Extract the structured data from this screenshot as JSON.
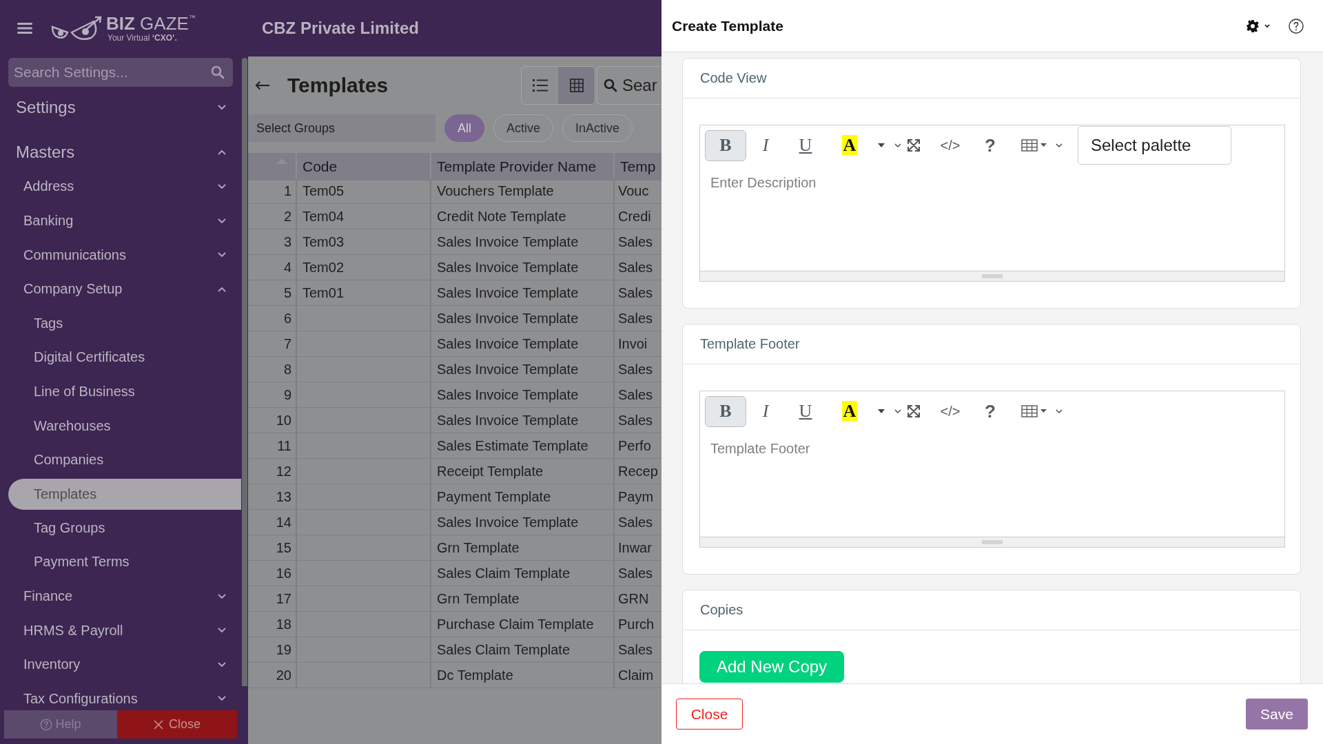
{
  "brand": {
    "name_1": "BIZ",
    "name_2": "GAZE",
    "tm": "™",
    "tagline": "Your Virtual **‘CXO’.**"
  },
  "company": "CBZ Private Limited",
  "sidebar": {
    "search": {
      "placeholder": "Search Settings..."
    },
    "items": [
      {
        "label": "Settings",
        "expanded": false
      },
      {
        "label": "Masters",
        "expanded": true,
        "children": [
          {
            "label": "Address",
            "expanded": false
          },
          {
            "label": "Banking",
            "expanded": false
          },
          {
            "label": "Communications",
            "expanded": false
          },
          {
            "label": "Company Setup",
            "expanded": true,
            "children": [
              {
                "label": "Tags",
                "selected": false
              },
              {
                "label": "Digital Certificates",
                "selected": false
              },
              {
                "label": "Line of Business",
                "selected": false
              },
              {
                "label": "Warehouses",
                "selected": false
              },
              {
                "label": "Companies",
                "selected": false
              },
              {
                "label": "Templates",
                "selected": true
              },
              {
                "label": "Tag Groups",
                "selected": false
              },
              {
                "label": "Payment Terms",
                "selected": false
              }
            ]
          },
          {
            "label": "Finance",
            "expanded": false
          },
          {
            "label": "HRMS & Payroll",
            "expanded": false
          },
          {
            "label": "Inventory",
            "expanded": false
          },
          {
            "label": "Tax Configurations",
            "expanded": false
          }
        ]
      }
    ],
    "footer": {
      "help": "Help",
      "close": "Close"
    }
  },
  "main": {
    "title": "Templates",
    "views": [
      {
        "kind": "list",
        "selected": false
      },
      {
        "kind": "grid",
        "selected": true
      }
    ],
    "search": {
      "placeholder": "Sear"
    },
    "groups": {
      "placeholder": "Select Groups"
    },
    "filters": [
      {
        "label": "All",
        "selected": true
      },
      {
        "label": "Active",
        "selected": false
      },
      {
        "label": "InActive",
        "selected": false
      }
    ],
    "table": {
      "columns": [
        "Code",
        "Template Provider Name",
        "Temp"
      ],
      "rows": [
        {
          "number": "1",
          "code": "Tem05",
          "provider": "Vouchers Template",
          "column_3": "Vouc"
        },
        {
          "number": "2",
          "code": "Tem04",
          "provider": "Credit Note Template",
          "column_3": "Credi"
        },
        {
          "number": "3",
          "code": "Tem03",
          "provider": "Sales Invoice Template",
          "column_3": "Sales"
        },
        {
          "number": "4",
          "code": "Tem02",
          "provider": "Sales Invoice Template",
          "column_3": "Sales"
        },
        {
          "number": "5",
          "code": "Tem01",
          "provider": "Sales Invoice Template",
          "column_3": "Sales"
        },
        {
          "number": "6",
          "provider": "Sales Invoice Template",
          "column_3": "Sales"
        },
        {
          "number": "7",
          "provider": "Sales Invoice Template",
          "column_3": "Invoi"
        },
        {
          "number": "8",
          "provider": "Sales Invoice Template",
          "column_3": "Sales"
        },
        {
          "number": "9",
          "provider": "Sales Invoice Template",
          "column_3": "Sales"
        },
        {
          "number": "10",
          "provider": "Sales Invoice Template",
          "column_3": "Sales"
        },
        {
          "number": "11",
          "provider": "Sales Estimate Template",
          "column_3": "Perfo"
        },
        {
          "number": "12",
          "provider": "Receipt Template",
          "column_3": "Recep"
        },
        {
          "number": "13",
          "provider": "Payment Template",
          "column_3": "Paym"
        },
        {
          "number": "14",
          "provider": "Sales Invoice Template",
          "column_3": "Sales"
        },
        {
          "number": "15",
          "provider": "Grn Template",
          "column_3": "Inwar"
        },
        {
          "number": "16",
          "provider": "Sales Claim Template",
          "column_3": "Sales"
        },
        {
          "number": "17",
          "provider": "Grn Template",
          "column_3": "GRN"
        },
        {
          "number": "18",
          "provider": "Purchase Claim Template",
          "column_3": "Purch"
        },
        {
          "number": "19",
          "provider": "Sales Claim Template",
          "column_3": "Sales"
        },
        {
          "number": "20",
          "provider": "Dc Template",
          "column_3": "Claim"
        }
      ]
    }
  },
  "drawer": {
    "title": "Create Template",
    "sections": [
      {
        "kind": "editor",
        "title": "Code View",
        "placeholder": "Enter Description",
        "palette": {
          "placeholder": "Select palette"
        },
        "toolbar": [
          {
            "kind": "bold",
            "label": "B",
            "active": true
          },
          {
            "kind": "italic",
            "label": "I",
            "active": false
          },
          {
            "kind": "underline",
            "label": "U",
            "active": false
          },
          {
            "kind": "highlight",
            "label": "A",
            "active": false
          },
          {
            "kind": "caret",
            "active": false
          },
          {
            "kind": "chevron",
            "active": false
          },
          {
            "kind": "expand",
            "active": false
          },
          {
            "kind": "code",
            "label": "</>",
            "active": false
          },
          {
            "kind": "help",
            "label": "?",
            "active": false
          },
          {
            "kind": "table",
            "active": false
          },
          {
            "kind": "chevron",
            "active": false
          }
        ]
      },
      {
        "kind": "editor",
        "title": "Template Footer",
        "placeholder": "Template Footer",
        "toolbar": [
          {
            "kind": "bold",
            "label": "B",
            "active": true
          },
          {
            "kind": "italic",
            "label": "I",
            "active": false
          },
          {
            "kind": "underline",
            "label": "U",
            "active": false
          },
          {
            "kind": "highlight",
            "label": "A",
            "active": false
          },
          {
            "kind": "caret",
            "active": false
          },
          {
            "kind": "chevron",
            "active": false
          },
          {
            "kind": "expand",
            "active": false
          },
          {
            "kind": "code",
            "label": "</>",
            "active": false
          },
          {
            "kind": "help",
            "label": "?",
            "active": false
          },
          {
            "kind": "table",
            "active": false
          },
          {
            "kind": "chevron",
            "active": false
          }
        ]
      },
      {
        "kind": "copies",
        "title": "Copies",
        "button": "Add New Copy"
      }
    ],
    "footer": {
      "close": "Close",
      "save": "Save"
    }
  }
}
